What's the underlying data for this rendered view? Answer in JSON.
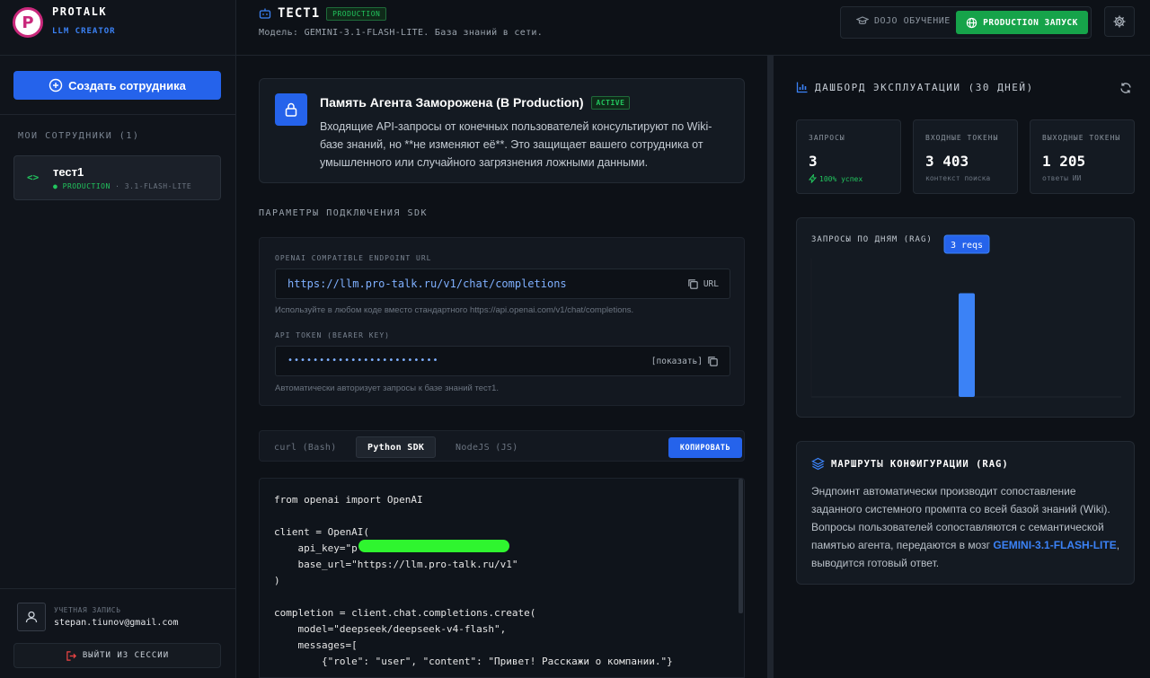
{
  "app": {
    "name": "PROTALK",
    "subtitle": "LLM CREATOR",
    "logo_letter": "P"
  },
  "sidebar": {
    "create_label": "Создать сотрудника",
    "section_label": "МОИ СОТРУДНИКИ (1)",
    "employees": [
      {
        "name": "тест1",
        "status": "● PRODUCTION",
        "model": "· 3.1-FLASH-LITE"
      }
    ],
    "account": {
      "label": "УЧЕТНАЯ ЗАПИСЬ",
      "email": "stepan.tiunov@gmail.com"
    },
    "logout_label": "ВЫЙТИ ИЗ СЕССИИ"
  },
  "header": {
    "title": "ТЕСТ1",
    "badge": "PRODUCTION",
    "model_line": "Модель: GEMINI-3.1-FLASH-LITE. База знаний в сети.",
    "dojo_label": "DOJO ОБУЧЕНИЕ",
    "prod_label": "PRODUCTION ЗАПУСК"
  },
  "alert": {
    "title": "Память Агента Заморожена (В Production)",
    "badge": "ACTIVE",
    "body": "Входящие API-запросы от конечных пользователей консультируют по Wiki-базе знаний, но **не изменяют её**. Это защищает вашего сотрудника от умышленного или случайного загрязнения ложными данными."
  },
  "sdk": {
    "section_label": "ПАРАМЕТРЫ ПОДКЛЮЧЕНИЯ SDK",
    "endpoint_label": "OPENAI COMPATIBLE ENDPOINT URL",
    "endpoint_value": "https://llm.pro-talk.ru/v1/chat/completions",
    "endpoint_copy": "URL",
    "endpoint_hint": "Используйте в любом коде вместо стандартного https://api.openai.com/v1/chat/completions.",
    "token_label": "API TOKEN (BEARER KEY)",
    "token_value": "••••••••••••••••••••••••",
    "token_show": "[показать]",
    "token_hint": "Автоматически авторизует запросы к базе знаний тест1."
  },
  "tabs": {
    "items": [
      "curl (Bash)",
      "Python SDK",
      "NodeJS (JS)"
    ],
    "active": "Python SDK",
    "copy_label": "КОПИРОВАТЬ"
  },
  "code": {
    "lines": [
      "from openai import OpenAI",
      "",
      "client = OpenAI(",
      "    api_key=\"p",
      "    base_url=\"https://llm.pro-talk.ru/v1\"",
      ")",
      "",
      "completion = client.chat.completions.create(",
      "    model=\"deepseek/deepseek-v4-flash\",",
      "    messages=[",
      "        {\"role\": \"user\", \"content\": \"Привет! Расскажи о компании.\"}"
    ]
  },
  "dashboard": {
    "title": "ДАШБОРД ЭКСПЛУАТАЦИИ (30 ДНЕЙ)",
    "stats": [
      {
        "label": "ЗАПРОСЫ",
        "value": "3",
        "sub": "100% успех"
      },
      {
        "label": "ВХОДНЫЕ ТОКЕНЫ",
        "value": "3 403",
        "sub": "контекст поиска"
      },
      {
        "label": "ВЫХОДНЫЕ ТОКЕНЫ",
        "value": "1 205",
        "sub": "ответы ИИ"
      }
    ]
  },
  "chart_data": {
    "type": "bar",
    "title": "ЗАПРОСЫ ПО ДНЯМ (RAG)",
    "values": [
      3
    ],
    "tooltip": "3 reqs",
    "ylim": [
      0,
      4
    ],
    "accent": "#3b82f6"
  },
  "route": {
    "title": "МАРШРУТЫ КОНФИГУРАЦИИ (RAG)",
    "body_pre": "Эндпоинт автоматически производит сопоставление заданного системного промпта со всей базой знаний (Wiki). Вопросы пользователей сопоставляются с семантической памятью агента, передаются в мозг ",
    "model": "GEMINI-3.1-FLASH-LITE",
    "body_post": ", выводится готовый ответ."
  },
  "colors": {
    "accent": "#2563eb",
    "success": "#16a34a",
    "bg": "#0d1117"
  }
}
